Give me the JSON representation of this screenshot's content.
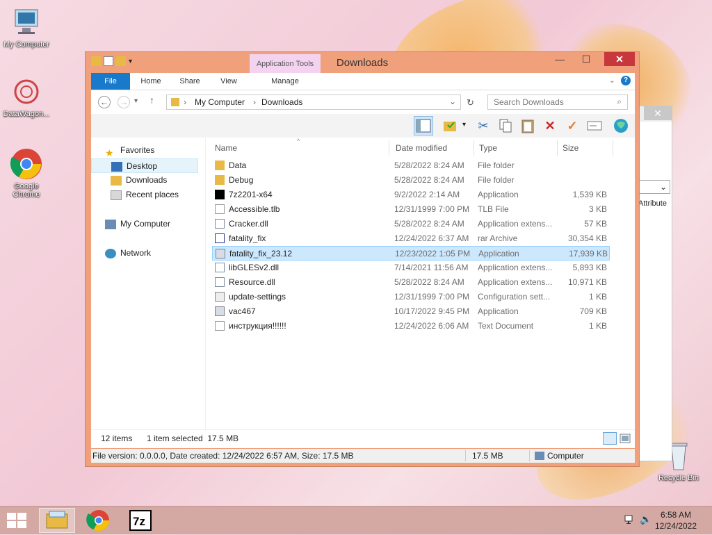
{
  "desktop": {
    "icons": [
      {
        "label": "My Computer"
      },
      {
        "label": "DataWagon..."
      },
      {
        "label": "Google Chrome"
      },
      {
        "label": "Recycle Bin"
      }
    ]
  },
  "window": {
    "title": "Downloads",
    "app_tools": "Application Tools",
    "close_glyph": "✕",
    "minimize_glyph": "—",
    "maximize_glyph": "☐",
    "ribbon_tabs": [
      "File",
      "Home",
      "Share",
      "View",
      "Manage"
    ],
    "help_glyph": "?",
    "breadcrumb": [
      "My Computer",
      "Downloads"
    ],
    "search_placeholder": "Search Downloads"
  },
  "nav": {
    "favorites": "Favorites",
    "desktop": "Desktop",
    "downloads": "Downloads",
    "recent": "Recent places",
    "computer": "My Computer",
    "network": "Network"
  },
  "columns": {
    "name": "Name",
    "date": "Date modified",
    "type": "Type",
    "size": "Size"
  },
  "files": [
    {
      "name": "Data",
      "date": "5/28/2022 8:24 AM",
      "type": "File folder",
      "size": "",
      "icon": "folder-icon"
    },
    {
      "name": "Debug",
      "date": "5/28/2022 8:24 AM",
      "type": "File folder",
      "size": "",
      "icon": "folder-icon"
    },
    {
      "name": "7z2201-x64",
      "date": "9/2/2022 2:14 AM",
      "type": "Application",
      "size": "1,539 KB",
      "icon": "7zip-icon"
    },
    {
      "name": "Accessible.tlb",
      "date": "12/31/1999 7:00 PM",
      "type": "TLB File",
      "size": "3 KB",
      "icon": "file-icon"
    },
    {
      "name": "Cracker.dll",
      "date": "5/28/2022 8:24 AM",
      "type": "Application extens...",
      "size": "57 KB",
      "icon": "dll-icon"
    },
    {
      "name": "fatality_fix",
      "date": "12/24/2022 6:37 AM",
      "type": "rar Archive",
      "size": "30,354 KB",
      "icon": "archive-icon"
    },
    {
      "name": "fatality_fix_23.12",
      "date": "12/23/2022 1:05 PM",
      "type": "Application",
      "size": "17,939 KB",
      "icon": "exe-icon"
    },
    {
      "name": "libGLESv2.dll",
      "date": "7/14/2021 11:56 AM",
      "type": "Application extens...",
      "size": "5,893 KB",
      "icon": "dll-icon"
    },
    {
      "name": "Resource.dll",
      "date": "5/28/2022 8:24 AM",
      "type": "Application extens...",
      "size": "10,971 KB",
      "icon": "dll-icon"
    },
    {
      "name": "update-settings",
      "date": "12/31/1999 7:00 PM",
      "type": "Configuration sett...",
      "size": "1 KB",
      "icon": "config-icon"
    },
    {
      "name": "vac467",
      "date": "10/17/2022 9:45 PM",
      "type": "Application",
      "size": "709 KB",
      "icon": "exe-icon"
    },
    {
      "name": "инструкция!!!!!!",
      "date": "12/24/2022 6:06 AM",
      "type": "Text Document",
      "size": "1 KB",
      "icon": "text-icon"
    }
  ],
  "selected_index": 6,
  "status": {
    "items": "12 items",
    "selection": "1 item selected  17.5 MB"
  },
  "details": {
    "info": "File version: 0.0.0.0, Date created: 12/24/2022 6:57 AM, Size: 17.5 MB",
    "size": "17.5 MB",
    "location": "Computer"
  },
  "bg_window": {
    "header": "Attribute"
  },
  "taskbar": {
    "time": "6:58 AM",
    "date": "12/24/2022"
  },
  "colors": {
    "accent": "#1979ca",
    "titlebar": "#f0a07a",
    "close": "#c7373c",
    "selection": "#cce8ff"
  }
}
